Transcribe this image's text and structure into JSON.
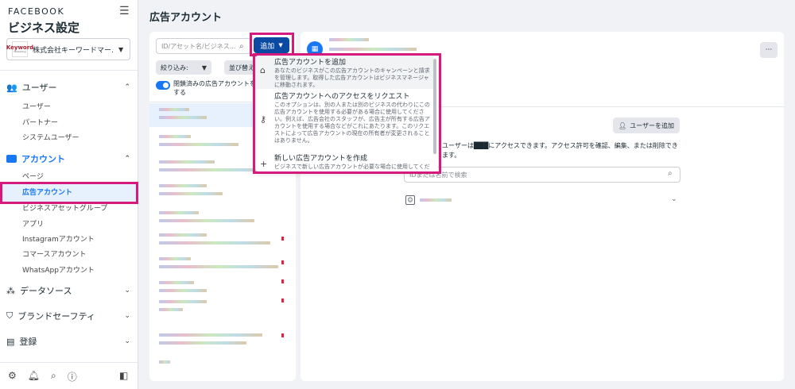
{
  "sidebar": {
    "brand": "FACEBOOK",
    "title": "ビジネス設定",
    "business": {
      "name": "株式会社キーワードマー...",
      "logo_main": "Keyword",
      "logo_sub": "Marketing"
    },
    "sections": [
      {
        "label": "ユーザー",
        "icon": "users-icon",
        "items": [
          "ユーザー",
          "パートナー",
          "システムユーザー"
        ]
      },
      {
        "label": "アカウント",
        "icon": "account-icon",
        "items": [
          "ページ",
          "広告アカウント",
          "ビジネスアセットグループ",
          "アプリ",
          "Instagramアカウント",
          "コマースアカウント",
          "WhatsAppアカウント"
        ]
      },
      {
        "label": "データソース",
        "icon": "datasource-icon"
      },
      {
        "label": "ブランドセーフティ",
        "icon": "shield-icon"
      },
      {
        "label": "登録",
        "icon": "register-icon"
      }
    ],
    "active_item": "広告アカウント"
  },
  "main": {
    "title": "広告アカウント"
  },
  "list": {
    "search_placeholder": "ID/アセット名/ビジネス...",
    "filter_label": "絞り込み:",
    "sort_label": "並び替え",
    "toggle_label": "閉鎖済みの広告アカウントを表示する"
  },
  "add_button": {
    "label": "追加"
  },
  "dropdown": {
    "items": [
      {
        "title": "広告アカウントを追加",
        "desc": "あなたのビジネスがこの広告アカウントのキャンペーンと請求を管理します。取得した広告アカウントはビジネスマネージャに移動されます。",
        "icon": "tag-icon"
      },
      {
        "title": "広告アカウントへのアクセスをリクエスト",
        "desc": "このオプションは、別の人または別のビジネスの代わりにこの広告アカウントを使用する必要がある場合に使用してください。例えば、広告会社のスタッフが、広告主が所有する広告アカウントを使用する場合などがこれにあたります。このリクエストによって広告アカウントの現在の所有者が変更されることはありません。",
        "icon": "key-icon"
      },
      {
        "title": "新しい広告アカウントを作成",
        "desc": "ビジネスで新しい広告アカウントが必要な場合に使用してくだ",
        "icon": "plus-icon"
      }
    ]
  },
  "detail": {
    "add_user_label": "ユーザーを追加",
    "access_text": "ユーザーは███にアクセスできます。アクセス許可を確認、編集、または削除できます。",
    "id_search_placeholder": "IDまたは名前で検索"
  },
  "colors": {
    "accent": "#1877f2",
    "highlight": "#d6197c",
    "add_button": "#0a4aa3"
  }
}
